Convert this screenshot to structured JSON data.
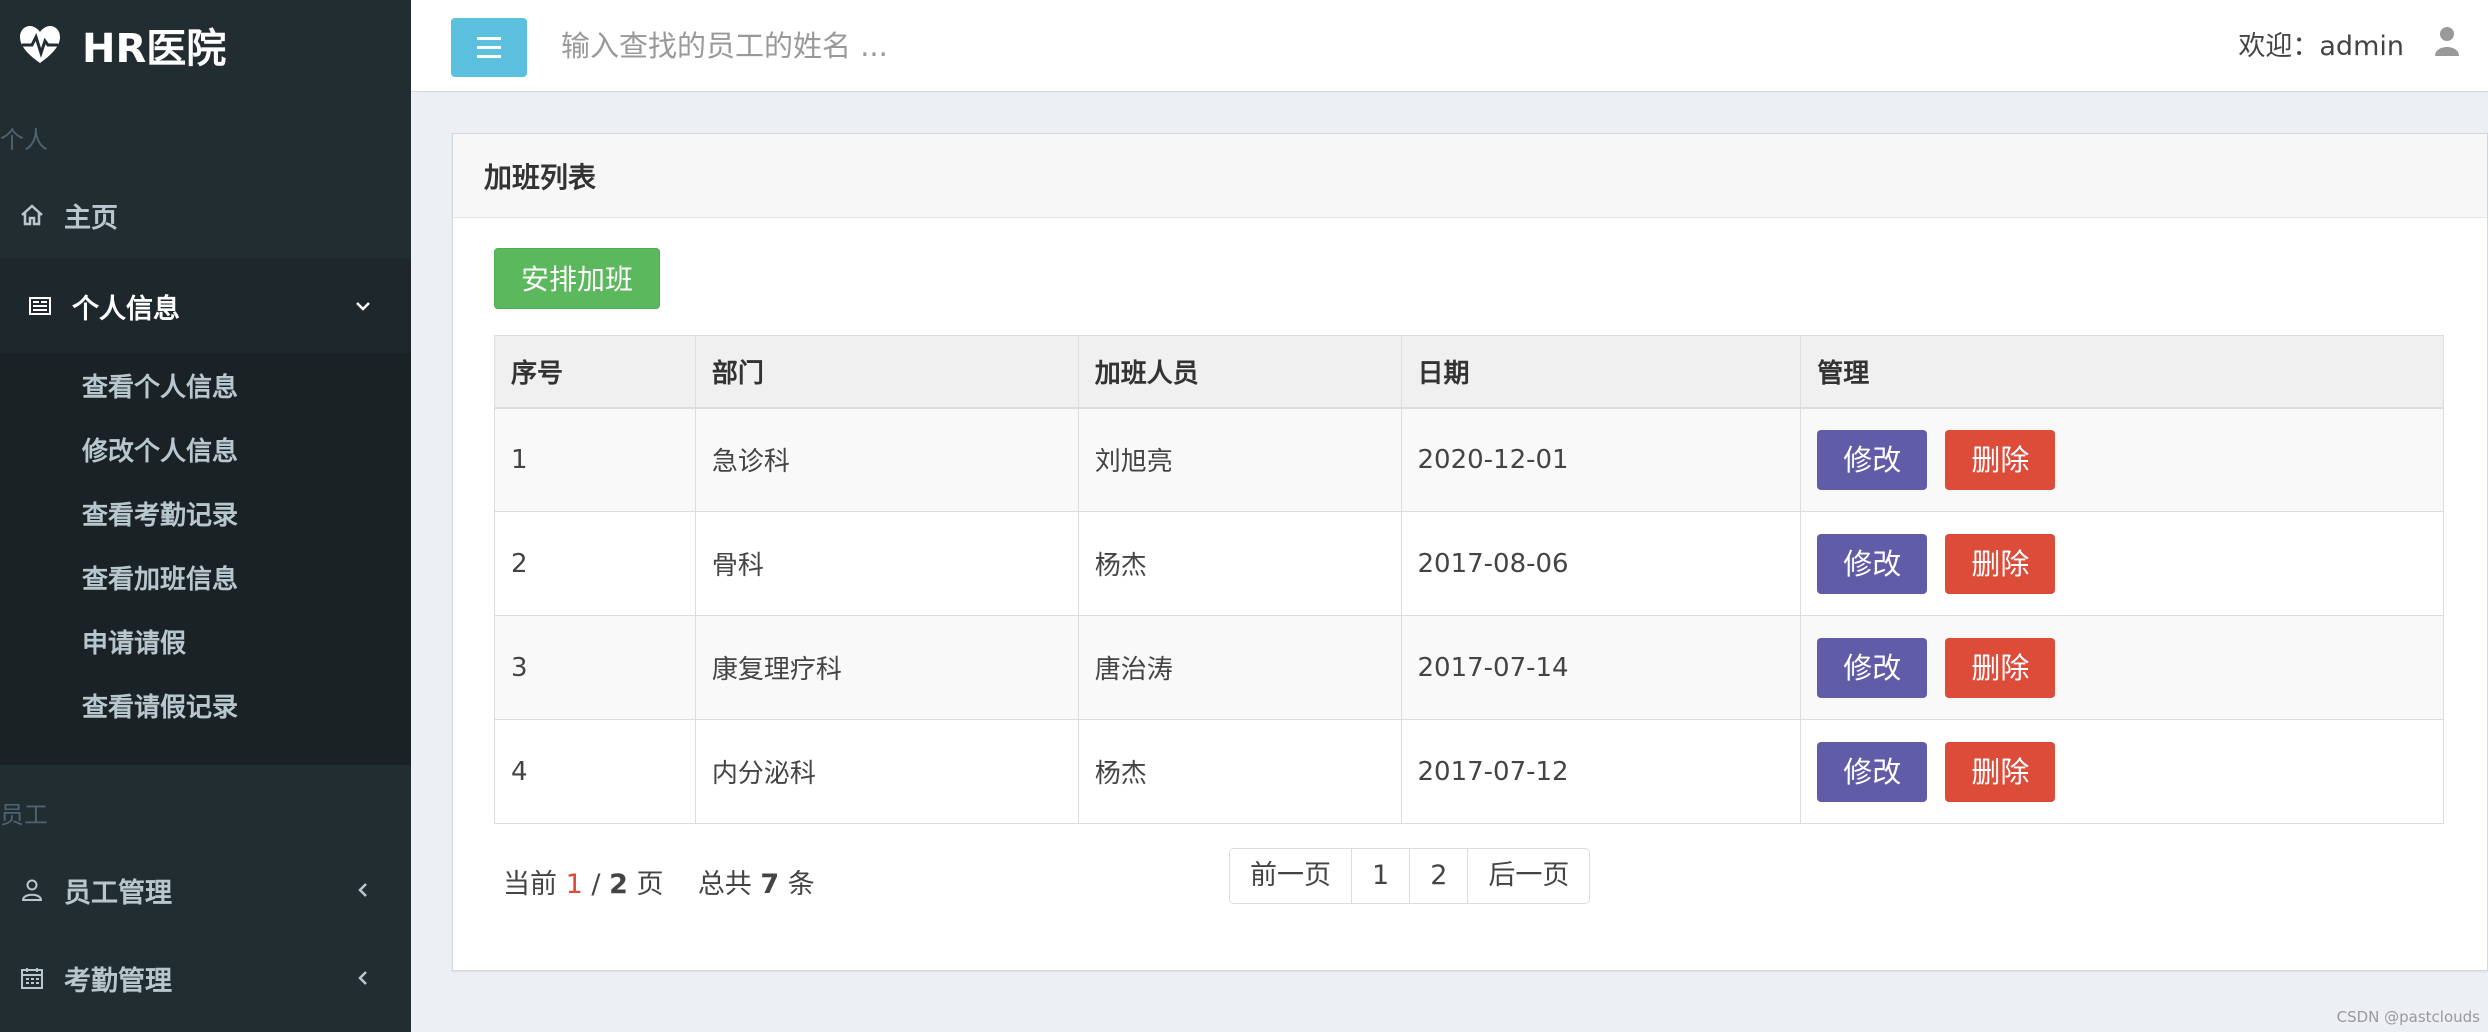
{
  "app": {
    "title": "HR医院"
  },
  "sidebar": {
    "section_personal": "个人",
    "home": "主页",
    "personal_info": "个人信息",
    "sub_items": [
      "查看个人信息",
      "修改个人信息",
      "查看考勤记录",
      "查看加班信息",
      "申请请假",
      "查看请假记录"
    ],
    "section_staff": "员工",
    "staff_manage": "员工管理",
    "attendance_manage": "考勤管理"
  },
  "header": {
    "search_placeholder": "输入查找的员工的姓名 ...",
    "welcome": "欢迎：admin"
  },
  "box": {
    "title": "加班列表",
    "add_label": "安排加班",
    "columns": [
      "序号",
      "部门",
      "加班人员",
      "日期",
      "管理"
    ],
    "rows": [
      {
        "id": "1",
        "dept": "急诊科",
        "person": "刘旭亮",
        "date": "2020-12-01"
      },
      {
        "id": "2",
        "dept": "骨科",
        "person": "杨杰",
        "date": "2017-08-06"
      },
      {
        "id": "3",
        "dept": "康复理疗科",
        "person": "唐治涛",
        "date": "2017-07-14"
      },
      {
        "id": "4",
        "dept": "内分泌科",
        "person": "杨杰",
        "date": "2017-07-12"
      }
    ],
    "edit_label": "修改",
    "delete_label": "删除"
  },
  "pager": {
    "prefix": "当前",
    "current": "1",
    "sep": "/",
    "total_pages": "2",
    "page_unit": "页",
    "total_prefix": "总共",
    "total_count": "7",
    "count_unit": "条",
    "prev": "前一页",
    "page1": "1",
    "page2": "2",
    "next": "后一页"
  },
  "watermark": "CSDN @pastclouds",
  "colors": {
    "sidebar": "#222d32",
    "accent": "#5bc0de",
    "success": "#5cb85c",
    "edit": "#605ca8",
    "delete": "#dd4b39"
  }
}
